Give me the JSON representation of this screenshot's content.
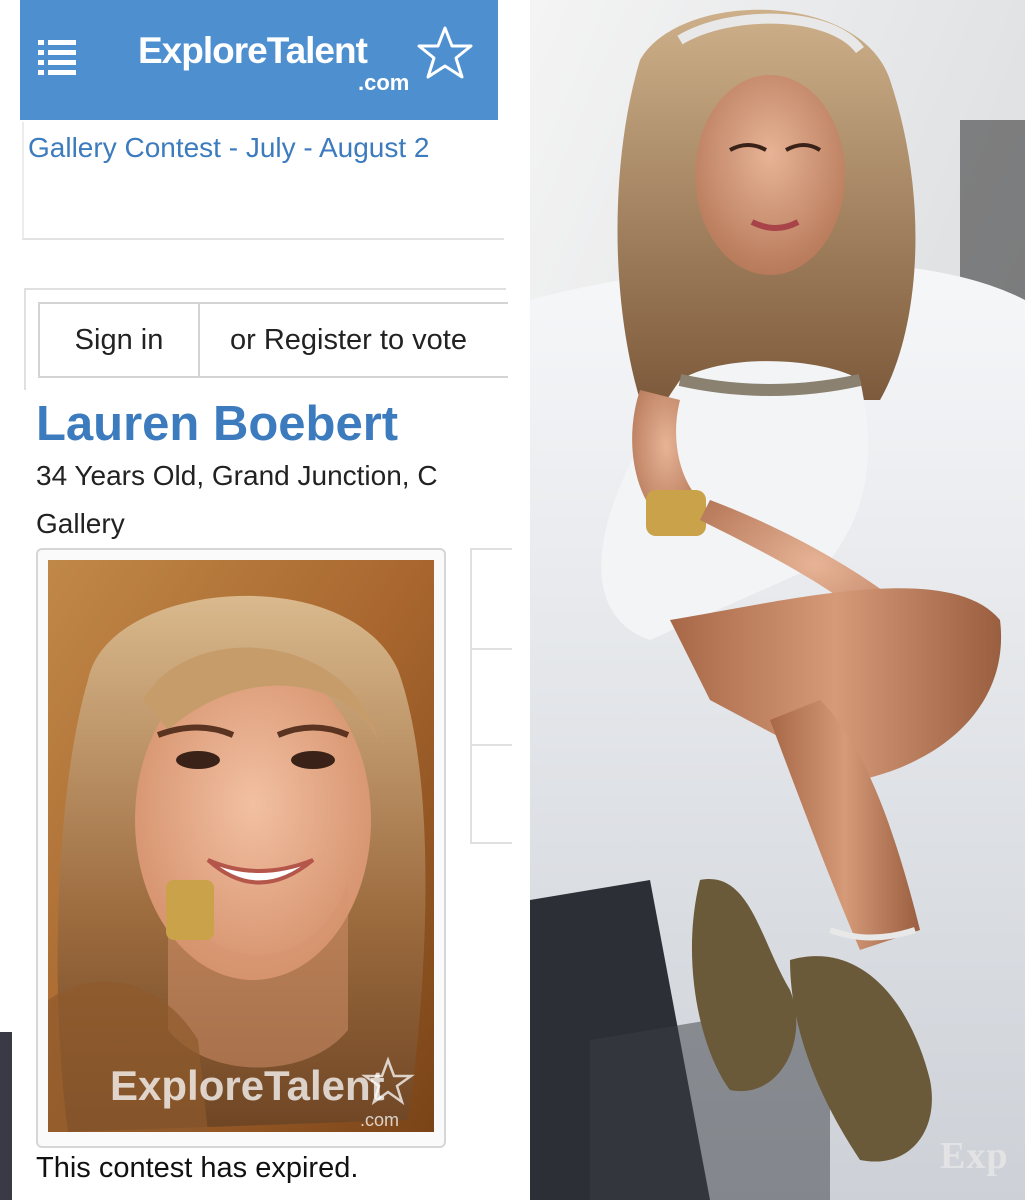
{
  "site": {
    "logo_text": "ExploreTalent",
    "logo_suffix": ".com"
  },
  "contest": {
    "title": "Gallery Contest - July - August 2"
  },
  "auth": {
    "sign_in_label": "Sign in",
    "register_label": "or Register to vote"
  },
  "profile": {
    "name": "Lauren Boebert",
    "meta": "34 Years Old, Grand Junction, C",
    "gallery_label": "Gallery",
    "photo_watermark": "ExploreTalent",
    "photo_watermark_suffix": ".com"
  },
  "status": {
    "expired_text": "This contest has expired."
  },
  "right_photo": {
    "watermark_fragment": "Exp"
  },
  "colors": {
    "header_bg": "#4e8fd0",
    "link_blue": "#3c7bbd"
  },
  "icons": {
    "menu": "hamburger-list-icon",
    "logo_star": "star-outline-icon"
  }
}
